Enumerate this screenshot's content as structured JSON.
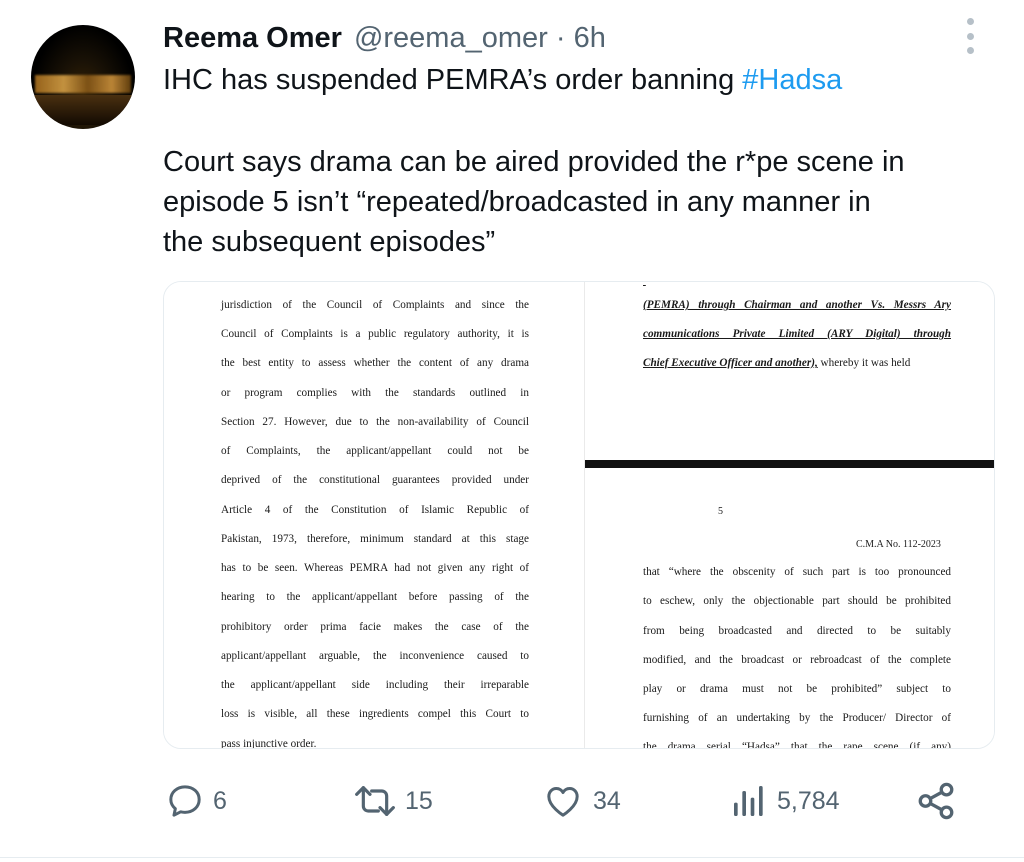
{
  "tweet": {
    "author_name": "Reema Omer",
    "handle": "@reema_omer",
    "separator": "·",
    "time": "6h",
    "text_line1": "IHC has suspended PEMRA’s order banning ",
    "hashtag": "#Hadsa",
    "text_line2": "Court says drama can be aired provided the r*pe scene in",
    "text_line3": "episode 5 isn’t “repeated/broadcasted in any manner in",
    "text_line4": "the subsequent episodes”"
  },
  "media": {
    "left_page": {
      "lines": [
        "jurisdiction of the Council of Complaints and since the",
        "Council of Complaints is a public regulatory authority, it is",
        "the best entity to assess whether the content of any drama",
        "or program complies with the standards outlined in",
        "Section 27. However, due to the non-availability of Council",
        "of Complaints, the applicant/appellant could not be",
        "deprived of the constitutional guarantees provided under",
        "Article 4 of the Constitution of Islamic Republic of",
        "Pakistan, 1973, therefore, minimum standard at this stage",
        "has to be seen. Whereas PEMRA had not given any right of",
        "hearing to the applicant/appellant before passing of the",
        "prohibitory order prima facie makes the case of the",
        "applicant/appellant arguable, the inconvenience caused to",
        "the applicant/appellant side including their irreparable",
        "loss is visible, all these ingredients compel this Court to",
        "pass injunctive order."
      ]
    },
    "right_page": {
      "top_lines": [
        "(PEMRA) through Chairman and another Vs. Messrs Ary",
        "communications Private Limited (ARY Digital) through",
        "Chief Executive Officer and another),",
        " whereby it was held"
      ],
      "page_number": "5",
      "case_ref": "C.M.A No. 112-2023",
      "bottom_lines": [
        "that “where the obscenity of such part is too pronounced",
        "to eschew, only the objectionable part should be prohibited",
        "from being broadcasted and directed to be suitably",
        "modified, and the broadcast or rebroadcast of the complete",
        "play or drama must not be prohibited” subject to",
        "furnishing of an undertaking by the Producer/ Director of",
        "the drama serial “Hadsa” that the rape scene (if any)"
      ]
    }
  },
  "actions": {
    "replies": "6",
    "retweets": "15",
    "likes": "34",
    "views": "5,784"
  },
  "icons": {
    "reply": "reply-icon",
    "retweet": "retweet-icon",
    "like": "heart-icon",
    "views": "views-icon",
    "share": "share-icon",
    "more": "more-icon"
  },
  "colors": {
    "text": "#0f1419",
    "secondary": "#536471",
    "link": "#1d9bf0"
  }
}
